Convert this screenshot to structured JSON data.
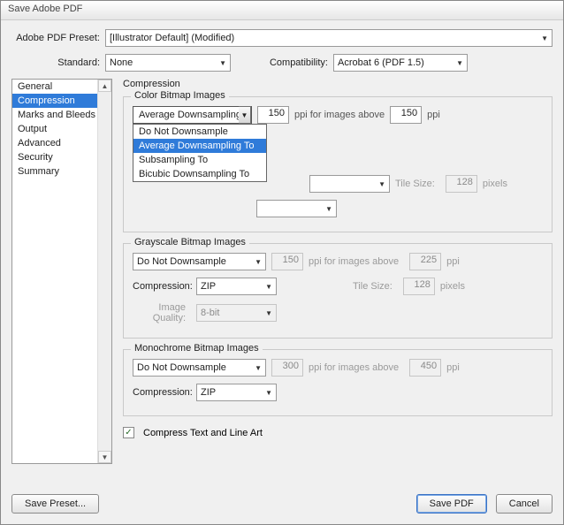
{
  "title": "Save Adobe PDF",
  "preset": {
    "label": "Adobe PDF Preset:",
    "value": "[Illustrator Default] (Modified)"
  },
  "standard": {
    "label": "Standard:",
    "value": "None"
  },
  "compat": {
    "label": "Compatibility:",
    "value": "Acrobat 6 (PDF 1.5)"
  },
  "sidebar": {
    "items": [
      "General",
      "Compression",
      "Marks and Bleeds",
      "Output",
      "Advanced",
      "Security",
      "Summary"
    ],
    "selectedIndex": 1
  },
  "section": "Compression",
  "color": {
    "legend": "Color Bitmap Images",
    "downsample": "Average Downsampling To",
    "dpi1": "150",
    "ppi_for": "ppi for images above",
    "dpi2": "150",
    "ppi": "ppi",
    "tile_lbl": "Tile Size:",
    "tile": "128",
    "tile_px": "pixels",
    "options": [
      "Do Not Downsample",
      "Average Downsampling To",
      "Subsampling To",
      "Bicubic Downsampling To"
    ]
  },
  "gray": {
    "legend": "Grayscale Bitmap Images",
    "downsample": "Do Not Downsample",
    "dpi1": "150",
    "ppi_for": "ppi for images above",
    "dpi2": "225",
    "ppi": "ppi",
    "comp_lbl": "Compression:",
    "comp": "ZIP",
    "tile_lbl": "Tile Size:",
    "tile": "128",
    "tile_px": "pixels",
    "iq_lbl": "Image Quality:",
    "iq": "8-bit"
  },
  "mono": {
    "legend": "Monochrome Bitmap Images",
    "downsample": "Do Not Downsample",
    "dpi1": "300",
    "ppi_for": "ppi for images above",
    "dpi2": "450",
    "ppi": "ppi",
    "comp_lbl": "Compression:",
    "comp": "ZIP"
  },
  "compress_text": "Compress Text and Line Art",
  "buttons": {
    "save_preset": "Save Preset...",
    "save_pdf": "Save PDF",
    "cancel": "Cancel"
  }
}
